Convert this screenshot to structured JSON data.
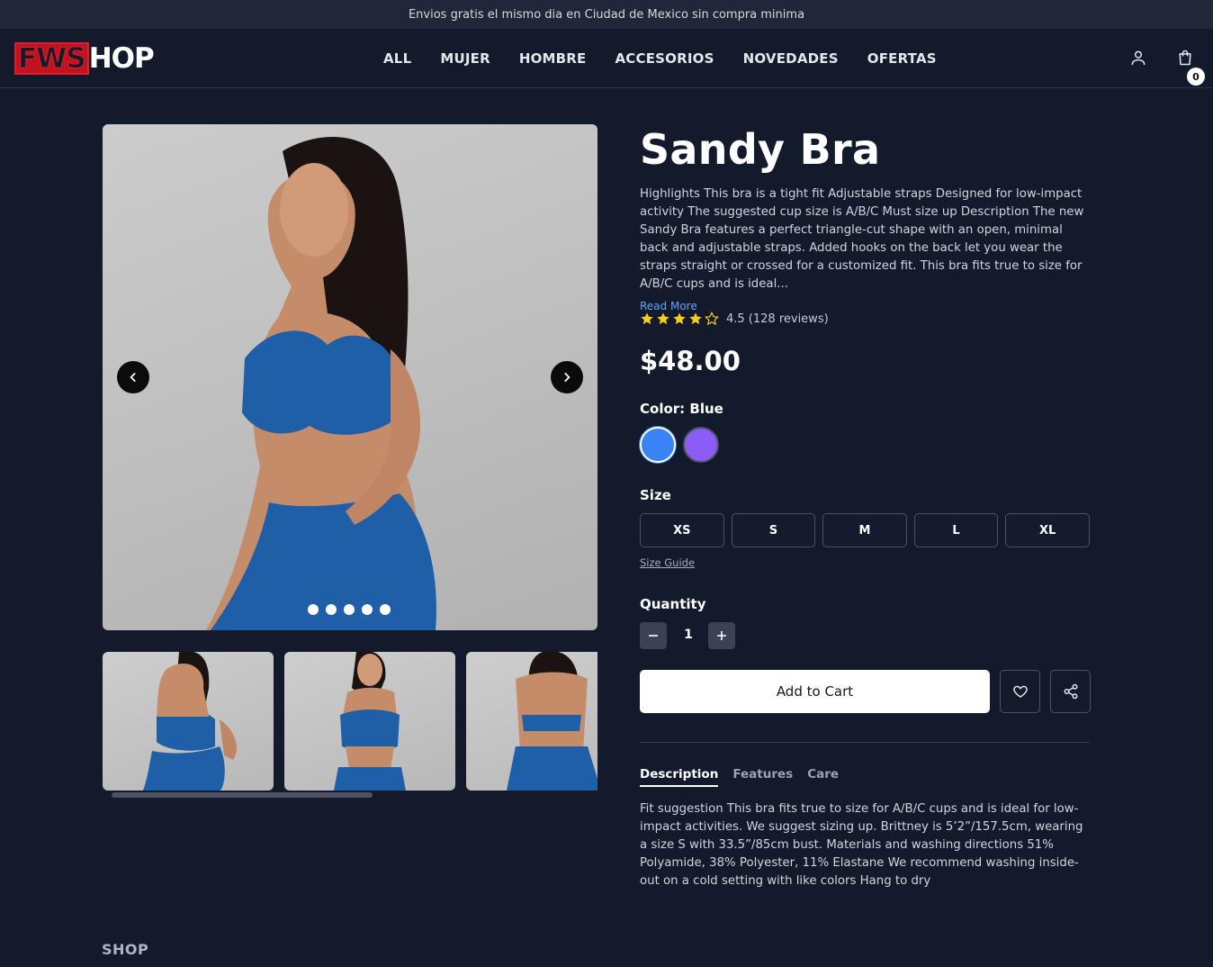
{
  "announcement": "Envios gratis el mismo dia en Ciudad de Mexico sin compra minima",
  "logo": {
    "part1": "FWS",
    "part2": "HOP"
  },
  "nav": [
    "ALL",
    "MUJER",
    "HOMBRE",
    "ACCESORIOS",
    "NOVEDADES",
    "OFERTAS"
  ],
  "cart": {
    "count": "0",
    "icon": "shopping-bag-icon"
  },
  "account_icon": "user-icon",
  "gallery": {
    "active_dot": 1,
    "dots": 5
  },
  "product": {
    "title": "Sandy Bra",
    "description": "Highlights This bra is a tight fit Adjustable straps Designed for low-impact activity The suggested cup size is A/B/C Must size up Description The new Sandy Bra features a perfect triangle-cut shape with an open, minimal back and adjustable straps. Added hooks on the back let you wear the straps straight or crossed for a customized fit. This bra fits true to size for A/B/C cups and is ideal...",
    "read_more": "Read More",
    "rating": 4.5,
    "rating_text": "4.5 (128 reviews)",
    "price": "$48.00",
    "color_label": "Color:",
    "color_value": "Blue",
    "colors": [
      "#3b82f6",
      "#8b5cf6"
    ],
    "size_label": "Size",
    "sizes": [
      "XS",
      "S",
      "M",
      "L",
      "XL"
    ],
    "size_guide": "Size Guide",
    "quantity_label": "Quantity",
    "quantity": "1",
    "add_to_cart": "Add to Cart"
  },
  "tabs": {
    "items": [
      "Description",
      "Features",
      "Care"
    ],
    "active": "Description",
    "content": "Fit suggestion This bra fits true to size for A/B/C cups and is ideal for low-impact activities. We suggest sizing up. Brittney is 5’2”/157.5cm, wearing a size S with 33.5”/85cm bust. Materials and washing directions 51% Polyamide, 38% Polyester, 11% Elastane We recommend washing inside-out on a cold setting with like colors Hang to dry"
  },
  "footer": {
    "shop_heading": "SHOP"
  }
}
